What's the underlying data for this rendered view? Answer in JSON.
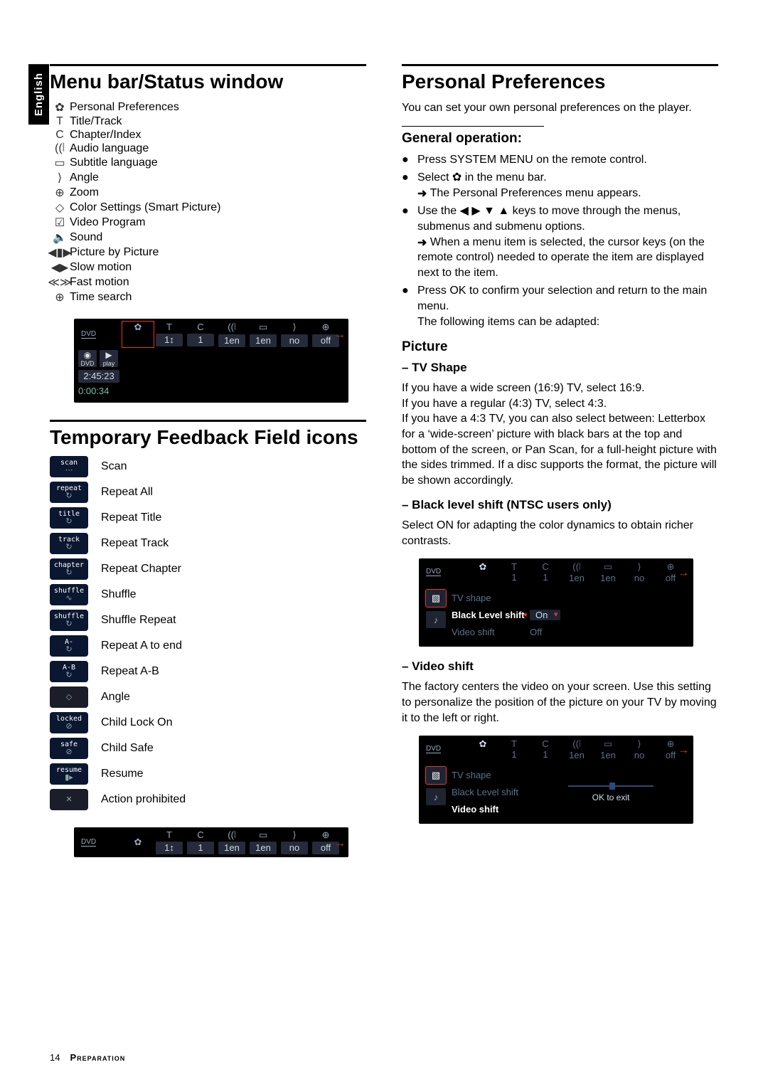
{
  "lang_tab": "English",
  "left": {
    "title": "Menu bar/Status window",
    "menu_items": [
      {
        "icon": "✿",
        "label": "Personal Preferences"
      },
      {
        "icon": "T",
        "label": "Title/Track"
      },
      {
        "icon": "C",
        "label": "Chapter/Index"
      },
      {
        "icon": "((⦚",
        "label": "Audio language"
      },
      {
        "icon": "▭",
        "label": "Subtitle language"
      },
      {
        "icon": "⟩",
        "label": "Angle"
      },
      {
        "icon": "⊕",
        "label": "Zoom"
      },
      {
        "icon": "◇",
        "label": "Color Settings (Smart Picture)"
      },
      {
        "icon": "☑",
        "label": "Video Program"
      },
      {
        "icon": "🔈",
        "label": "Sound"
      },
      {
        "icon": "◀▮▶",
        "label": "Picture by Picture"
      },
      {
        "icon": "◀▶",
        "label": "Slow motion"
      },
      {
        "icon": "≪≫",
        "label": "Fast motion"
      },
      {
        "icon": "⊕",
        "label": "Time search"
      }
    ],
    "menubar": {
      "disc": "DVD",
      "cells": [
        {
          "ic": "✿",
          "vl": ""
        },
        {
          "ic": "T",
          "vl": "1↕"
        },
        {
          "ic": "C",
          "vl": "1"
        },
        {
          "ic": "((⦚",
          "vl": "1en"
        },
        {
          "ic": "▭",
          "vl": "1en"
        },
        {
          "ic": "⟩",
          "vl": "no"
        },
        {
          "ic": "⊕",
          "vl": "off"
        }
      ]
    },
    "play_status": {
      "disc": "DVD",
      "cells": [
        {
          "ic": "✿",
          "vl": ""
        },
        {
          "ic": "T",
          "vl": "1↕"
        },
        {
          "ic": "C",
          "vl": "1"
        },
        {
          "ic": "((⦚",
          "vl": "1en"
        },
        {
          "ic": "▭",
          "vl": "1en"
        },
        {
          "ic": "⟩",
          "vl": "no"
        },
        {
          "ic": "⊕",
          "vl": "off"
        }
      ],
      "side1_top": "◉",
      "side1_bot": "DVD",
      "side2_top": "▶",
      "side2_bot": "play",
      "time1": "2:45:23",
      "time2": "0:00:34"
    },
    "feedback_title": "Temporary Feedback Field icons",
    "feedback": [
      {
        "t": "scan",
        "g": "⋯",
        "label": "Scan"
      },
      {
        "t": "repeat",
        "g": "↻",
        "label": "Repeat All"
      },
      {
        "t": "title",
        "g": "↻",
        "label": "Repeat Title"
      },
      {
        "t": "track",
        "g": "↻",
        "label": "Repeat Track"
      },
      {
        "t": "chapter",
        "g": "↻",
        "label": "Repeat Chapter"
      },
      {
        "t": "shuffle",
        "g": "∿",
        "label": "Shuffle"
      },
      {
        "t": "shuffle",
        "g": "↻",
        "label": "Shuffle Repeat"
      },
      {
        "t": "A-",
        "g": "↻",
        "label": "Repeat A to end"
      },
      {
        "t": "A-B",
        "g": "↻",
        "label": "Repeat A-B"
      },
      {
        "t": "",
        "g": "◇",
        "label": "Angle",
        "gray": true
      },
      {
        "t": "locked",
        "g": "⊘",
        "label": "Child Lock On"
      },
      {
        "t": "safe",
        "g": "⊘",
        "label": "Child Safe"
      },
      {
        "t": "resume",
        "g": "▮▸",
        "label": "Resume"
      },
      {
        "t": "",
        "g": "✕",
        "label": "Action prohibited",
        "gray": true
      }
    ],
    "bottom_bar": {
      "disc": "DVD",
      "cells": [
        {
          "ic": "✿",
          "vl": ""
        },
        {
          "ic": "T",
          "vl": "1↕"
        },
        {
          "ic": "C",
          "vl": "1"
        },
        {
          "ic": "((⦚",
          "vl": "1en"
        },
        {
          "ic": "▭",
          "vl": "1en"
        },
        {
          "ic": "⟩",
          "vl": "no"
        },
        {
          "ic": "⊕",
          "vl": "off"
        }
      ]
    }
  },
  "right": {
    "title": "Personal Preferences",
    "intro": "You can set your own personal preferences on the player.",
    "general_heading": "General operation:",
    "bullets": [
      {
        "main": "Press SYSTEM MENU on the remote control."
      },
      {
        "main": "Select ✿ in the menu bar.",
        "arrow": "The Personal Preferences menu appears."
      },
      {
        "main": "Use the ◀ ▶ ▼ ▲ keys to move through the menus, submenus and submenu options.",
        "arrow": "When a menu item is selected, the cursor keys (on the remote control) needed to operate the item are displayed next to the item."
      },
      {
        "main": "Press OK to confirm your selection and return to the main menu.",
        "tail": "The following items can be adapted:"
      }
    ],
    "picture_heading": "Picture",
    "tv_shape_heading": "–  TV Shape",
    "tv_shape_text": "If you have a wide screen (16:9) TV, select 16:9.\nIf you have a regular (4:3) TV, select 4:3.\nIf you have a 4:3 TV, you can also select between: Letterbox for a ‘wide-screen’ picture with black bars at the top and bottom of the screen, or Pan Scan, for a full-height picture with the sides trimmed. If a disc supports the format, the picture will be shown accordingly.",
    "bls_heading": "–  Black level shift (NTSC users only)",
    "bls_text": "Select ON for adapting the color dynamics to obtain richer contrasts.",
    "osd_bls": {
      "disc": "DVD",
      "cells": [
        {
          "ic": "✿",
          "vl": ""
        },
        {
          "ic": "T",
          "vl": "1"
        },
        {
          "ic": "C",
          "vl": "1"
        },
        {
          "ic": "((⦚",
          "vl": "1en"
        },
        {
          "ic": "▭",
          "vl": "1en"
        },
        {
          "ic": "⟩",
          "vl": "no"
        },
        {
          "ic": "⊕",
          "vl": "off"
        }
      ],
      "rows": [
        {
          "lab": "TV shape",
          "val": ""
        },
        {
          "lab": "Black Level shift",
          "val": "On",
          "sel": true
        },
        {
          "lab": "Video shift",
          "val": "Off"
        }
      ]
    },
    "vs_heading": "–  Video shift",
    "vs_text": "The factory centers the video on your screen. Use this setting to personalize the position of the picture on your TV by moving it to the left or right.",
    "osd_vs": {
      "disc": "DVD",
      "cells": [
        {
          "ic": "✿",
          "vl": ""
        },
        {
          "ic": "T",
          "vl": "1"
        },
        {
          "ic": "C",
          "vl": "1"
        },
        {
          "ic": "((⦚",
          "vl": "1en"
        },
        {
          "ic": "▭",
          "vl": "1en"
        },
        {
          "ic": "⟩",
          "vl": "no"
        },
        {
          "ic": "⊕",
          "vl": "off"
        }
      ],
      "rows": [
        {
          "lab": "TV shape"
        },
        {
          "lab": "Black Level shift"
        },
        {
          "lab": "Video shift",
          "sel": true
        }
      ],
      "ok": "OK to exit"
    }
  },
  "footer": {
    "page": "14",
    "section": "Preparation"
  }
}
